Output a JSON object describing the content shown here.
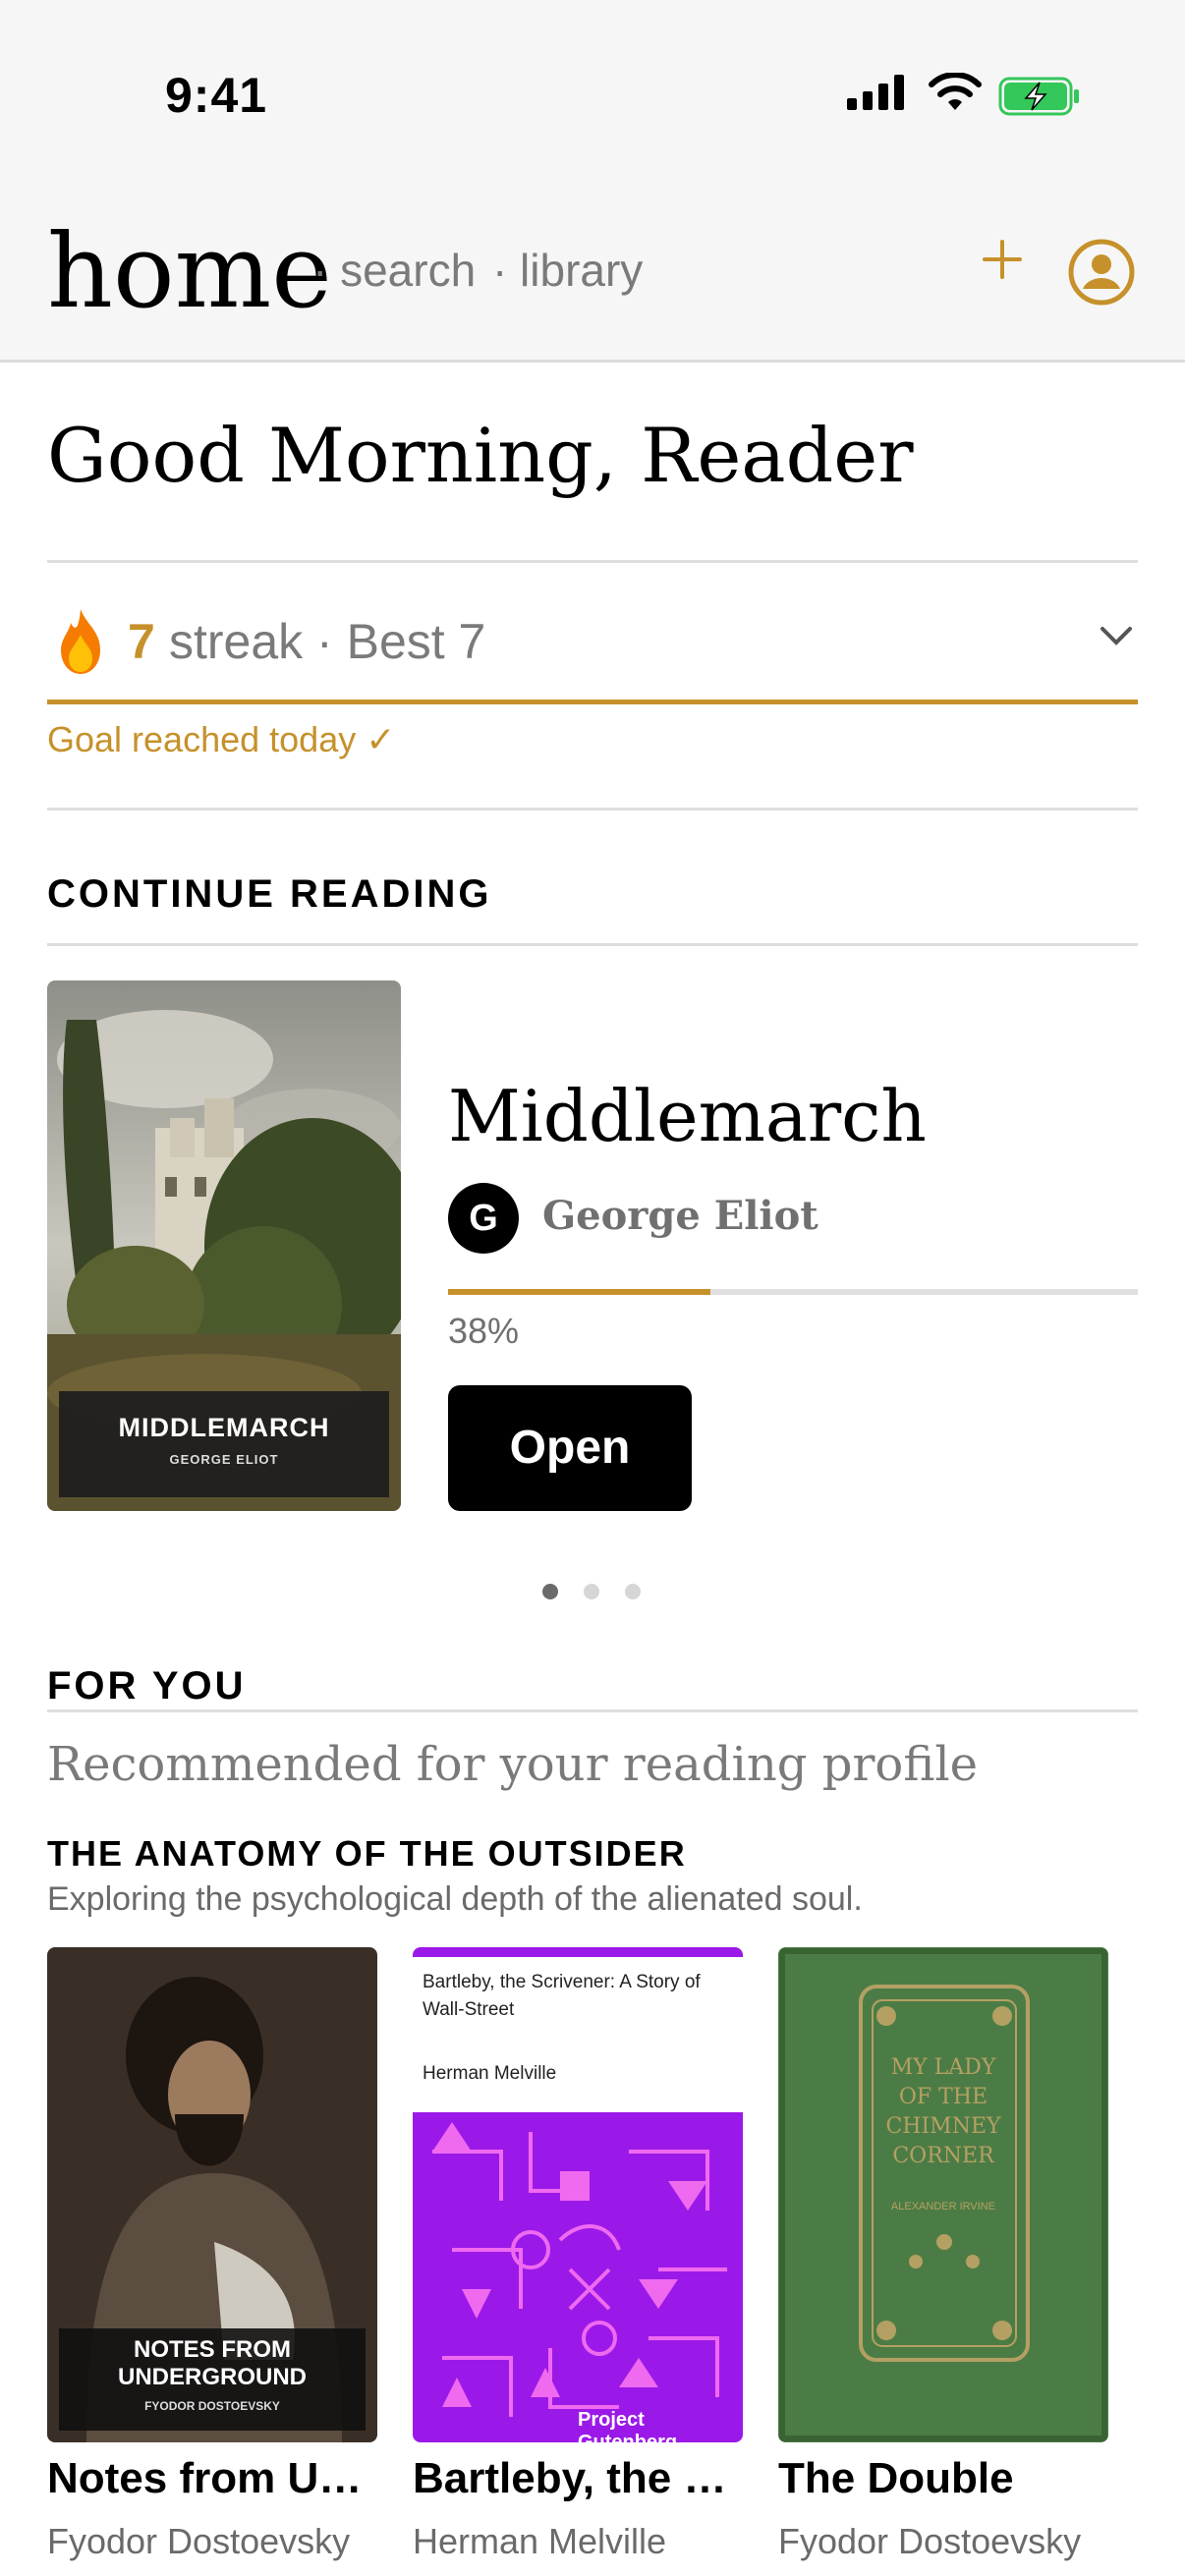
{
  "status_bar": {
    "time": "9:41"
  },
  "header": {
    "title": "home",
    "links": [
      "· search",
      "· library"
    ]
  },
  "greeting": "Good Morning, Reader",
  "streak": {
    "count": "7",
    "text": "streak · Best 7",
    "goal": "Goal reached today ✓"
  },
  "continue_reading": {
    "heading": "CONTINUE READING",
    "cover_title": "MIDDLEMARCH",
    "cover_author": "GEORGE ELIOT",
    "title": "Middlemarch",
    "author_initial": "G",
    "author": "George Eliot",
    "progress": 0.38,
    "progress_label": "38%",
    "open_label": "Open"
  },
  "for_you": {
    "heading": "FOR YOU",
    "subtitle": "Recommended for your reading profile",
    "shelf_title": "THE ANATOMY OF THE OUTSIDER",
    "shelf_desc": "Exploring the psychological depth of the alienated soul.",
    "books": [
      {
        "title": "Notes from Underground",
        "author": "Fyodor Dostoevsky",
        "cover_line1": "NOTES FROM",
        "cover_line2": "UNDERGROUND",
        "cover_author": "FYODOR DOSTOEVSKY"
      },
      {
        "title": "Bartleby, the Scrivener",
        "author": "Herman Melville",
        "cover_title": "Bartleby, the Scrivener: A Story of Wall-Street",
        "cover_author": "Herman Melville",
        "cover_publisher": "Project Gutenberg"
      },
      {
        "title": "The Double",
        "author": "Fyodor Dostoevsky",
        "cover_title": "MY LADY OF THE CHIMNEY CORNER",
        "cover_author": "ALEXANDER IRVINE"
      }
    ]
  },
  "colors": {
    "accent": "#c6912b",
    "muted": "#7a7a7a",
    "rule": "#dddddd"
  }
}
